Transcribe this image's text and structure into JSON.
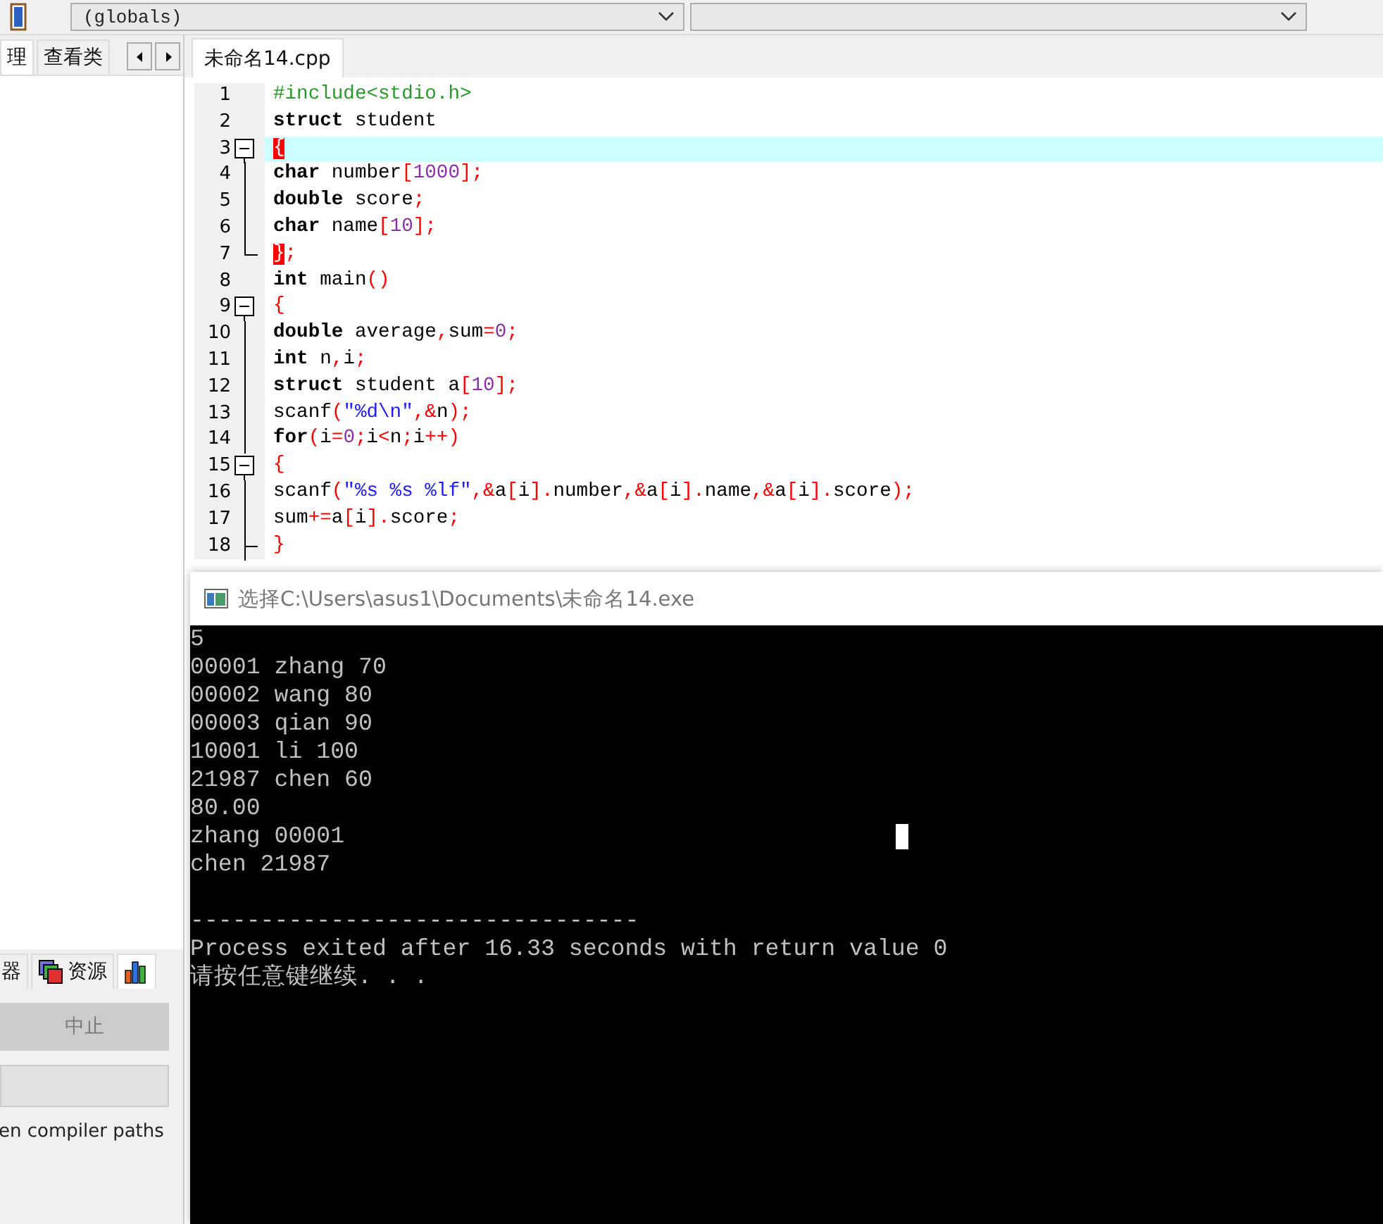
{
  "toolbar": {
    "scope_select": "(globals)"
  },
  "left_panel": {
    "tabs": [
      {
        "label": "理",
        "selected": true
      },
      {
        "label": "查看类",
        "selected": false
      }
    ],
    "bottom_tabs": [
      {
        "kind": "text",
        "label": "器",
        "selected": false
      },
      {
        "kind": "resources",
        "label": "资源",
        "selected": false
      },
      {
        "kind": "chart",
        "selected": true
      }
    ],
    "abort_button": {
      "label": "中止",
      "disabled": true
    },
    "note": "en compiler paths"
  },
  "editor": {
    "file_tabs": [
      {
        "label": "未命名14.cpp",
        "selected": true
      }
    ],
    "lines": [
      {
        "number": "1",
        "kind": "plain",
        "highlight": false,
        "tokens": [
          {
            "kind": "pre",
            "text": "#include<stdio.h>"
          }
        ]
      },
      {
        "number": "2",
        "kind": "plain",
        "highlight": false,
        "tokens": [
          {
            "kind": "kw",
            "text": "struct"
          },
          {
            "kind": "id",
            "text": " student"
          }
        ]
      },
      {
        "number": "3",
        "kind": "open",
        "highlight": true,
        "tokens": [
          {
            "kind": "match",
            "text": "{"
          }
        ]
      },
      {
        "number": "4",
        "kind": "inner",
        "highlight": false,
        "tokens": [
          {
            "kind": "kw",
            "text": "char"
          },
          {
            "kind": "id",
            "text": " number"
          },
          {
            "kind": "p",
            "text": "["
          },
          {
            "kind": "num",
            "text": "1000"
          },
          {
            "kind": "p",
            "text": "];"
          }
        ]
      },
      {
        "number": "5",
        "kind": "inner",
        "highlight": false,
        "tokens": [
          {
            "kind": "kw",
            "text": "double"
          },
          {
            "kind": "id",
            "text": " score"
          },
          {
            "kind": "p",
            "text": ";"
          }
        ]
      },
      {
        "number": "6",
        "kind": "inner",
        "highlight": false,
        "tokens": [
          {
            "kind": "kw",
            "text": "char"
          },
          {
            "kind": "id",
            "text": " name"
          },
          {
            "kind": "p",
            "text": "["
          },
          {
            "kind": "num",
            "text": "10"
          },
          {
            "kind": "p",
            "text": "];"
          }
        ]
      },
      {
        "number": "7",
        "kind": "end",
        "highlight": false,
        "tokens": [
          {
            "kind": "match",
            "text": "}"
          },
          {
            "kind": "p",
            "text": ";"
          }
        ]
      },
      {
        "number": "8",
        "kind": "plain",
        "highlight": false,
        "tokens": [
          {
            "kind": "kw",
            "text": "int"
          },
          {
            "kind": "id",
            "text": " main"
          },
          {
            "kind": "p",
            "text": "()"
          }
        ]
      },
      {
        "number": "9",
        "kind": "open",
        "highlight": false,
        "tokens": [
          {
            "kind": "p",
            "text": "{"
          }
        ]
      },
      {
        "number": "10",
        "kind": "inner",
        "highlight": false,
        "tokens": [
          {
            "kind": "kw",
            "text": "double"
          },
          {
            "kind": "id",
            "text": " average"
          },
          {
            "kind": "p",
            "text": ","
          },
          {
            "kind": "id",
            "text": "sum"
          },
          {
            "kind": "p",
            "text": "="
          },
          {
            "kind": "num",
            "text": "0"
          },
          {
            "kind": "p",
            "text": ";"
          }
        ]
      },
      {
        "number": "11",
        "kind": "inner",
        "highlight": false,
        "tokens": [
          {
            "kind": "kw",
            "text": "int"
          },
          {
            "kind": "id",
            "text": " n"
          },
          {
            "kind": "p",
            "text": ","
          },
          {
            "kind": "id",
            "text": "i"
          },
          {
            "kind": "p",
            "text": ";"
          }
        ]
      },
      {
        "number": "12",
        "kind": "inner",
        "highlight": false,
        "tokens": [
          {
            "kind": "kw",
            "text": "struct"
          },
          {
            "kind": "id",
            "text": " student a"
          },
          {
            "kind": "p",
            "text": "["
          },
          {
            "kind": "num",
            "text": "10"
          },
          {
            "kind": "p",
            "text": "];"
          }
        ]
      },
      {
        "number": "13",
        "kind": "inner",
        "highlight": false,
        "tokens": [
          {
            "kind": "id",
            "text": "scanf"
          },
          {
            "kind": "p",
            "text": "("
          },
          {
            "kind": "str",
            "text": "\"%d\\n\""
          },
          {
            "kind": "p",
            "text": ",&"
          },
          {
            "kind": "id",
            "text": "n"
          },
          {
            "kind": "p",
            "text": ");"
          }
        ]
      },
      {
        "number": "14",
        "kind": "inner",
        "highlight": false,
        "tokens": [
          {
            "kind": "kw",
            "text": "for"
          },
          {
            "kind": "p",
            "text": "("
          },
          {
            "kind": "id",
            "text": "i"
          },
          {
            "kind": "p",
            "text": "="
          },
          {
            "kind": "num",
            "text": "0"
          },
          {
            "kind": "p",
            "text": ";"
          },
          {
            "kind": "id",
            "text": "i"
          },
          {
            "kind": "p",
            "text": "<"
          },
          {
            "kind": "id",
            "text": "n"
          },
          {
            "kind": "p",
            "text": ";"
          },
          {
            "kind": "id",
            "text": "i"
          },
          {
            "kind": "p",
            "text": "++)"
          }
        ]
      },
      {
        "number": "15",
        "kind": "open",
        "highlight": false,
        "tokens": [
          {
            "kind": "p",
            "text": "{"
          }
        ]
      },
      {
        "number": "16",
        "kind": "inner",
        "highlight": false,
        "tokens": [
          {
            "kind": "id",
            "text": "scanf"
          },
          {
            "kind": "p",
            "text": "("
          },
          {
            "kind": "str",
            "text": "\"%s %s %lf\""
          },
          {
            "kind": "p",
            "text": ",&"
          },
          {
            "kind": "id",
            "text": "a"
          },
          {
            "kind": "p",
            "text": "["
          },
          {
            "kind": "id",
            "text": "i"
          },
          {
            "kind": "p",
            "text": "]."
          },
          {
            "kind": "id",
            "text": "number"
          },
          {
            "kind": "p",
            "text": ",&"
          },
          {
            "kind": "id",
            "text": "a"
          },
          {
            "kind": "p",
            "text": "["
          },
          {
            "kind": "id",
            "text": "i"
          },
          {
            "kind": "p",
            "text": "]."
          },
          {
            "kind": "id",
            "text": "name"
          },
          {
            "kind": "p",
            "text": ",&"
          },
          {
            "kind": "id",
            "text": "a"
          },
          {
            "kind": "p",
            "text": "["
          },
          {
            "kind": "id",
            "text": "i"
          },
          {
            "kind": "p",
            "text": "]."
          },
          {
            "kind": "id",
            "text": "score"
          },
          {
            "kind": "p",
            "text": ");"
          }
        ]
      },
      {
        "number": "17",
        "kind": "inner",
        "highlight": false,
        "tokens": [
          {
            "kind": "id",
            "text": "sum"
          },
          {
            "kind": "p",
            "text": "+="
          },
          {
            "kind": "id",
            "text": "a"
          },
          {
            "kind": "p",
            "text": "["
          },
          {
            "kind": "id",
            "text": "i"
          },
          {
            "kind": "p",
            "text": "]."
          },
          {
            "kind": "id",
            "text": "score"
          },
          {
            "kind": "p",
            "text": ";"
          }
        ]
      },
      {
        "number": "18",
        "kind": "branch",
        "highlight": false,
        "tokens": [
          {
            "kind": "p",
            "text": "}"
          }
        ]
      }
    ]
  },
  "console": {
    "title": "选择C:\\Users\\asus1\\Documents\\未命名14.exe",
    "output": [
      "5",
      "00001 zhang 70",
      "00002 wang 80",
      "00003 qian 90",
      "10001 li 100",
      "21987 chen 60",
      "80.00",
      "zhang 00001",
      "chen 21987"
    ],
    "footer": [
      "--------------------------------",
      "Process exited after 16.33 seconds with return value 0",
      "请按任意键继续. . ."
    ]
  }
}
